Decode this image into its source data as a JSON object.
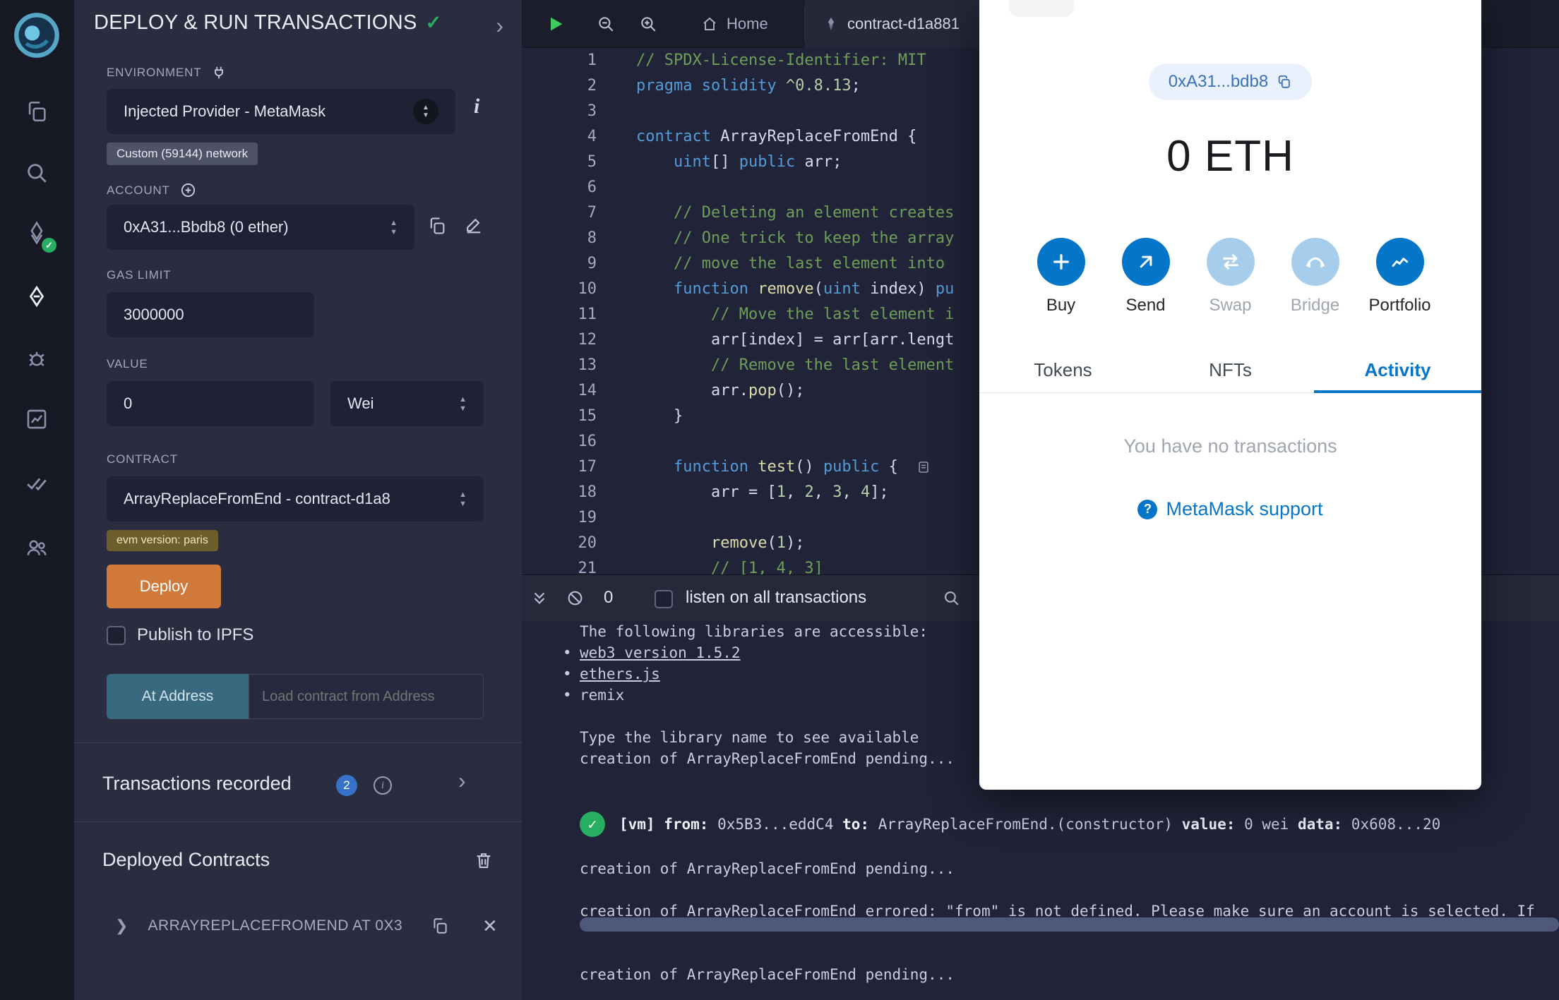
{
  "activity_bar": {
    "icons": [
      {
        "name": "file-explorer-icon"
      },
      {
        "name": "search-icon"
      },
      {
        "name": "solidity-compiler-icon",
        "badge": "check"
      },
      {
        "name": "deploy-run-icon",
        "active": true
      },
      {
        "name": "debugger-icon"
      },
      {
        "name": "analysis-icon"
      },
      {
        "name": "unit-testing-icon"
      },
      {
        "name": "plugin-manager-icon"
      }
    ]
  },
  "side_panel": {
    "title": "DEPLOY & RUN TRANSACTIONS",
    "environment": {
      "label": "ENVIRONMENT",
      "value": "Injected Provider - MetaMask",
      "network_badge": "Custom (59144) network"
    },
    "account": {
      "label": "ACCOUNT",
      "value": "0xA31...Bbdb8 (0 ether)"
    },
    "gas_limit": {
      "label": "GAS LIMIT",
      "value": "3000000"
    },
    "value": {
      "label": "VALUE",
      "amount": "0",
      "unit": "Wei"
    },
    "contract": {
      "label": "CONTRACT",
      "value": "ArrayReplaceFromEnd - contract-d1a8",
      "evm_badge": "evm version: paris"
    },
    "deploy_button": "Deploy",
    "publish_label": "Publish to IPFS",
    "at_address_button": "At Address",
    "at_address_placeholder": "Load contract from Address",
    "transactions_recorded": {
      "label": "Transactions recorded",
      "count": "2"
    },
    "deployed_contracts": {
      "label": "Deployed Contracts",
      "item": "ARRAYREPLACEFROMEND AT 0X3"
    }
  },
  "editor": {
    "tabs": [
      {
        "label": "Home"
      },
      {
        "label": "contract-d1a881"
      }
    ],
    "lines": [
      {
        "n": "1",
        "s": [
          [
            "cm",
            "// SPDX-License-Identifier: MIT"
          ]
        ]
      },
      {
        "n": "2",
        "s": [
          [
            "kw",
            "pragma solidity"
          ],
          [
            "pl",
            " "
          ],
          [
            "num",
            "^0.8.13"
          ],
          [
            "pl",
            ";"
          ]
        ]
      },
      {
        "n": "3",
        "s": []
      },
      {
        "n": "4",
        "s": [
          [
            "kw",
            "contract"
          ],
          [
            "pl",
            " ArrayReplaceFromEnd {"
          ]
        ]
      },
      {
        "n": "5",
        "s": [
          [
            "pl",
            "    "
          ],
          [
            "kw",
            "uint"
          ],
          [
            "pl",
            "[] "
          ],
          [
            "kw",
            "public"
          ],
          [
            "pl",
            " arr;"
          ]
        ]
      },
      {
        "n": "6",
        "s": []
      },
      {
        "n": "7",
        "s": [
          [
            "pl",
            "    "
          ],
          [
            "cm",
            "// Deleting an element creates"
          ]
        ]
      },
      {
        "n": "8",
        "s": [
          [
            "pl",
            "    "
          ],
          [
            "cm",
            "// One trick to keep the array"
          ]
        ]
      },
      {
        "n": "9",
        "s": [
          [
            "pl",
            "    "
          ],
          [
            "cm",
            "// move the last element into"
          ]
        ]
      },
      {
        "n": "10",
        "s": [
          [
            "pl",
            "    "
          ],
          [
            "kw",
            "function"
          ],
          [
            "pl",
            " "
          ],
          [
            "fn",
            "remove"
          ],
          [
            "pl",
            "("
          ],
          [
            "kw",
            "uint"
          ],
          [
            "pl",
            " index) "
          ],
          [
            "kw",
            "pu"
          ]
        ]
      },
      {
        "n": "11",
        "s": [
          [
            "pl",
            "        "
          ],
          [
            "cm",
            "// Move the last element i"
          ]
        ]
      },
      {
        "n": "12",
        "s": [
          [
            "pl",
            "        arr[index] = arr[arr.lengt"
          ]
        ]
      },
      {
        "n": "13",
        "s": [
          [
            "pl",
            "        "
          ],
          [
            "cm",
            "// Remove the last element"
          ]
        ]
      },
      {
        "n": "14",
        "s": [
          [
            "pl",
            "        arr."
          ],
          [
            "fn",
            "pop"
          ],
          [
            "pl",
            "();"
          ]
        ]
      },
      {
        "n": "15",
        "s": [
          [
            "pl",
            "    }"
          ]
        ]
      },
      {
        "n": "16",
        "s": []
      },
      {
        "n": "17",
        "s": [
          [
            "pl",
            "    "
          ],
          [
            "kw",
            "function"
          ],
          [
            "pl",
            " "
          ],
          [
            "fn",
            "test"
          ],
          [
            "pl",
            "() "
          ],
          [
            "kw",
            "public"
          ],
          [
            "pl",
            " {"
          ]
        ],
        "deco": "test-log-icon"
      },
      {
        "n": "18",
        "s": [
          [
            "pl",
            "        arr = ["
          ],
          [
            "num",
            "1"
          ],
          [
            "pl",
            ", "
          ],
          [
            "num",
            "2"
          ],
          [
            "pl",
            ", "
          ],
          [
            "num",
            "3"
          ],
          [
            "pl",
            ", "
          ],
          [
            "num",
            "4"
          ],
          [
            "pl",
            "];"
          ]
        ]
      },
      {
        "n": "19",
        "s": []
      },
      {
        "n": "20",
        "s": [
          [
            "pl",
            "        "
          ],
          [
            "fn",
            "remove"
          ],
          [
            "pl",
            "("
          ],
          [
            "num",
            "1"
          ],
          [
            "pl",
            ");"
          ]
        ]
      },
      {
        "n": "21",
        "s": [
          [
            "pl",
            "        "
          ],
          [
            "cm",
            "// [1, 4, 3]"
          ]
        ]
      }
    ]
  },
  "terminal": {
    "toolbar": {
      "count": "0",
      "listen_label": "listen on all transactions"
    },
    "lines": [
      {
        "t": "The following libraries are accessible:"
      },
      {
        "bullet": true,
        "u": true,
        "t": "web3 version 1.5.2"
      },
      {
        "bullet": true,
        "u": true,
        "t": "ethers.js"
      },
      {
        "bullet": true,
        "t": "remix"
      },
      {
        "t": ""
      },
      {
        "t": "Type the library name to see available"
      },
      {
        "t": "creation of ArrayReplaceFromEnd pending..."
      },
      {
        "t": ""
      },
      {
        "t": ""
      },
      {
        "vm": true,
        "s": [
          [
            "b",
            "[vm]"
          ],
          [
            "t",
            " "
          ],
          [
            "b",
            "from:"
          ],
          [
            "t",
            " 0x5B3...eddC4 "
          ],
          [
            "b",
            "to:"
          ],
          [
            "t",
            " ArrayReplaceFromEnd.(constructor) "
          ],
          [
            "b",
            "value:"
          ],
          [
            "t",
            " 0 wei "
          ],
          [
            "b",
            "data:"
          ],
          [
            "t",
            " 0x608...20"
          ]
        ]
      },
      {
        "t": ""
      },
      {
        "t": "creation of ArrayReplaceFromEnd pending..."
      },
      {
        "t": ""
      },
      {
        "t": "creation of ArrayReplaceFromEnd errored: \"from\" is not defined. Please make sure an account is selected. If"
      },
      {
        "t": ""
      },
      {
        "t": ""
      },
      {
        "t": "creation of ArrayReplaceFromEnd pending..."
      }
    ]
  },
  "metamask": {
    "address_pill": "0xA31...bdb8",
    "balance": "0 ETH",
    "actions": [
      {
        "label": "Buy",
        "icon": "plus-icon",
        "enabled": true
      },
      {
        "label": "Send",
        "icon": "send-arrow-icon",
        "enabled": true
      },
      {
        "label": "Swap",
        "icon": "swap-icon",
        "enabled": false
      },
      {
        "label": "Bridge",
        "icon": "bridge-icon",
        "enabled": false
      },
      {
        "label": "Portfolio",
        "icon": "portfolio-chart-icon",
        "enabled": true
      }
    ],
    "tabs": [
      {
        "label": "Tokens",
        "active": false
      },
      {
        "label": "NFTs",
        "active": false
      },
      {
        "label": "Activity",
        "active": true
      }
    ],
    "empty_text": "You have no transactions",
    "support_link": "MetaMask support"
  }
}
